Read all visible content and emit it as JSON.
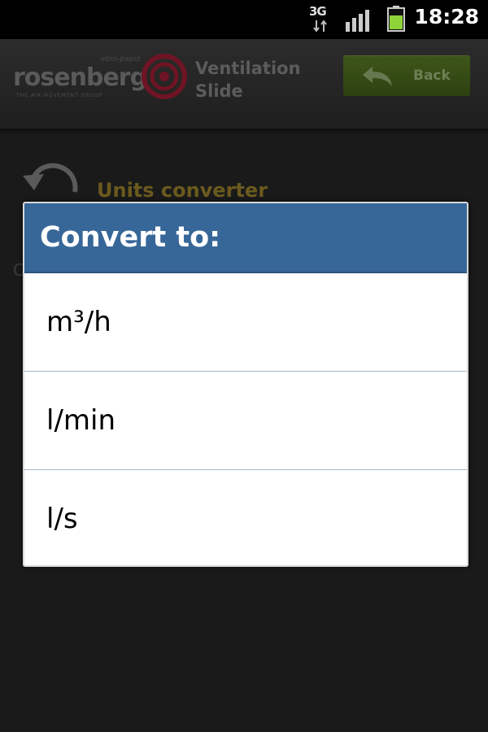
{
  "status_bar": {
    "network": "3G",
    "time": "18:28",
    "battery_color": "#8fd33a"
  },
  "header": {
    "logo_word": "rosenberg",
    "logo_tagline": "THE AIR MOVEMENT GROUP",
    "logo_small_brand": "ebm-papst",
    "logo_color": "#a0152c",
    "app_title": "Ventilation Slide",
    "back_label": "Back",
    "back_color": "#3e5619"
  },
  "content": {
    "section_title": "Units converter",
    "obscured_letter": "C"
  },
  "dialog": {
    "title": "Convert to:",
    "header_color": "#376798",
    "options": [
      {
        "label": "m³/h"
      },
      {
        "label": "l/min"
      },
      {
        "label": "l/s"
      }
    ]
  }
}
